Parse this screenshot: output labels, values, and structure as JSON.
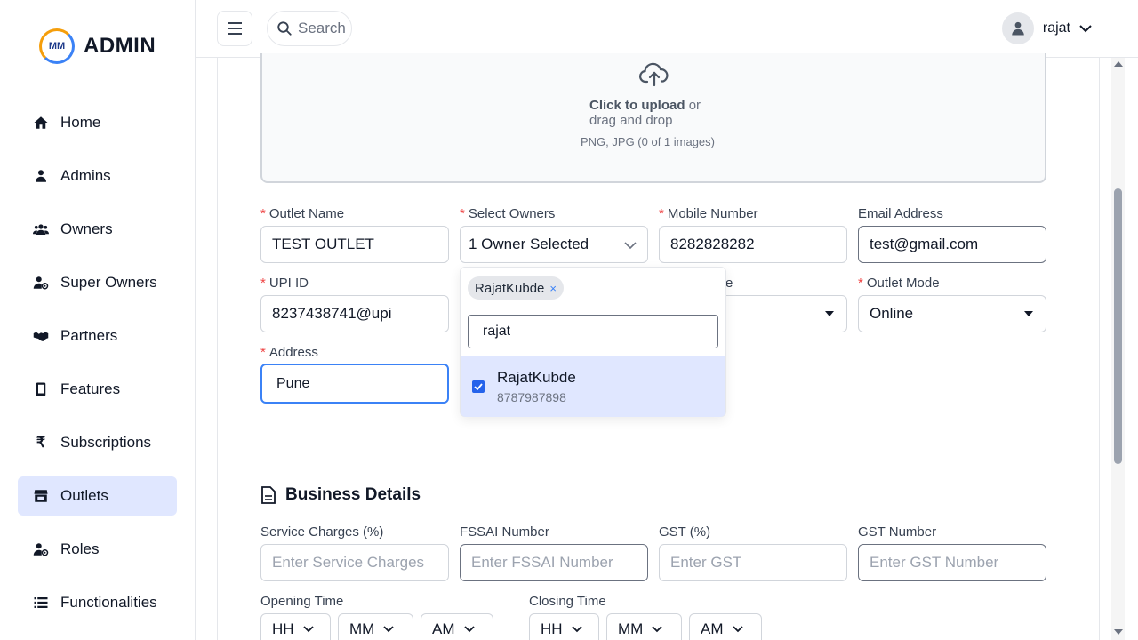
{
  "brand": {
    "logo_text": "MM",
    "name": "ADMIN"
  },
  "sidebar": {
    "items": [
      {
        "label": "Home",
        "icon": "home-icon"
      },
      {
        "label": "Admins",
        "icon": "user-icon"
      },
      {
        "label": "Owners",
        "icon": "users-icon"
      },
      {
        "label": "Super Owners",
        "icon": "user-gear-icon"
      },
      {
        "label": "Partners",
        "icon": "handshake-icon"
      },
      {
        "label": "Features",
        "icon": "mobile-icon"
      },
      {
        "label": "Subscriptions",
        "icon": "rupee-icon"
      },
      {
        "label": "Outlets",
        "icon": "store-icon",
        "active": true
      },
      {
        "label": "Roles",
        "icon": "user-gear-icon"
      },
      {
        "label": "Functionalities",
        "icon": "list-icon"
      }
    ]
  },
  "header": {
    "search_placeholder": "Search",
    "username": "rajat"
  },
  "upload": {
    "click_text": "Click to upload",
    "or_text": "or",
    "drag_text": "drag and drop",
    "hint": "PNG, JPG (0 of 1 images)"
  },
  "form": {
    "outlet_name": {
      "label": "Outlet Name",
      "value": "TEST OUTLET"
    },
    "select_owners": {
      "label": "Select Owners",
      "value": "1 Owner Selected"
    },
    "mobile": {
      "label": "Mobile Number",
      "value": "8282828282"
    },
    "email": {
      "label": "Email Address",
      "value": "test@gmail.com"
    },
    "upi": {
      "label": "UPI ID",
      "value": "8237438741@upi"
    },
    "hidden_label_tail": "e",
    "outlet_mode": {
      "label": "Outlet Mode",
      "value": "Online"
    },
    "address": {
      "label": "Address",
      "value": "Pune"
    }
  },
  "owner_dropdown": {
    "chip": "RajatKubde",
    "chip_remove": "×",
    "search_value": "rajat",
    "option": {
      "name": "RajatKubde",
      "phone": "8787987898",
      "checked": true
    }
  },
  "business": {
    "title": "Business Details",
    "service_charges": {
      "label": "Service Charges (%)",
      "placeholder": "Enter Service Charges"
    },
    "fssai": {
      "label": "FSSAI Number",
      "placeholder": "Enter FSSAI Number"
    },
    "gst": {
      "label": "GST (%)",
      "placeholder": "Enter GST"
    },
    "gst_number": {
      "label": "GST Number",
      "placeholder": "Enter GST Number"
    },
    "opening_time": {
      "label": "Opening Time",
      "hh": "HH",
      "mm": "MM",
      "ampm": "AM"
    },
    "closing_time": {
      "label": "Closing Time",
      "hh": "HH",
      "mm": "MM",
      "ampm": "AM"
    }
  },
  "colors": {
    "accent": "#3b82f6",
    "active_nav": "#e0e7ff",
    "required": "#ef4444"
  }
}
